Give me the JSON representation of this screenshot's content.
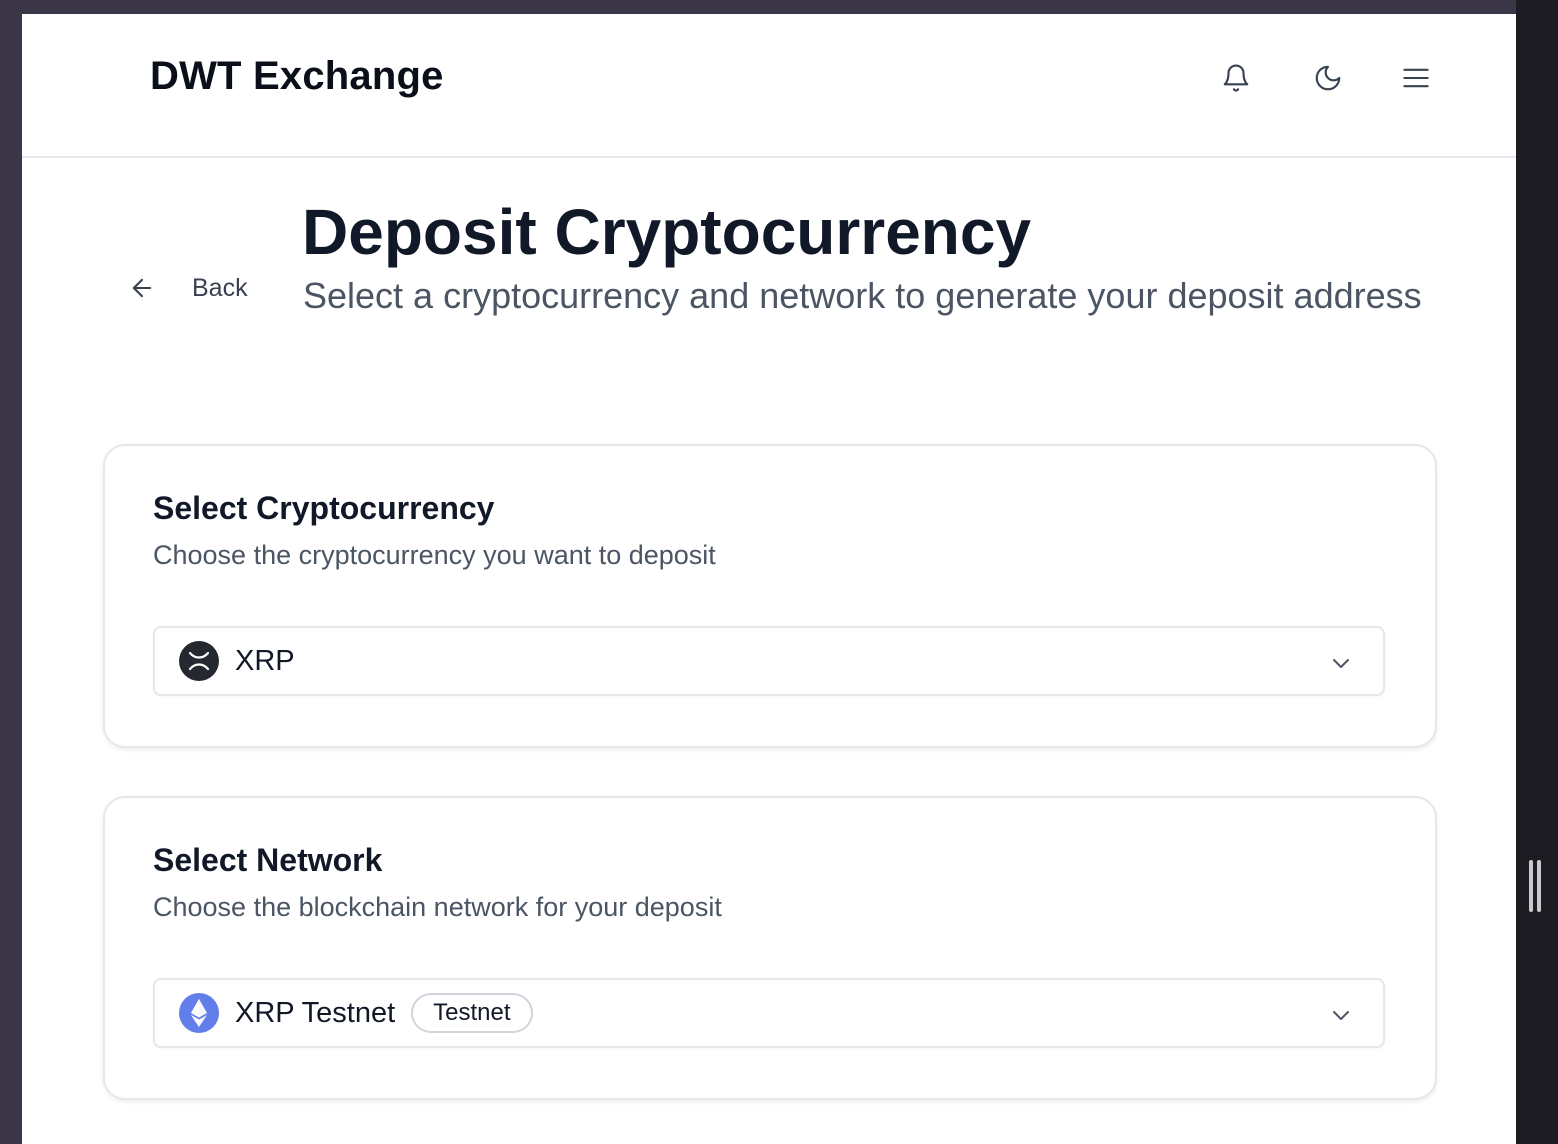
{
  "header": {
    "brand": "DWT Exchange",
    "icons": [
      "bell-icon",
      "moon-icon",
      "menu-icon"
    ]
  },
  "nav": {
    "back_label": "Back"
  },
  "page": {
    "title": "Deposit Cryptocurrency",
    "subtitle": "Select a cryptocurrency and network to generate your deposit address"
  },
  "crypto_card": {
    "title": "Select Cryptocurrency",
    "description": "Choose the cryptocurrency you want to deposit",
    "selected": "XRP",
    "icon": "xrp-coin-icon"
  },
  "network_card": {
    "title": "Select Network",
    "description": "Choose the blockchain network for your deposit",
    "selected": "XRP Testnet",
    "badge": "Testnet",
    "icon": "ethereum-coin-icon"
  },
  "colors": {
    "text_primary": "#111827",
    "text_secondary": "#4b5563",
    "border": "#e5e7eb",
    "xrp_icon_bg": "#23292f",
    "eth_icon_bg": "#627eea"
  }
}
